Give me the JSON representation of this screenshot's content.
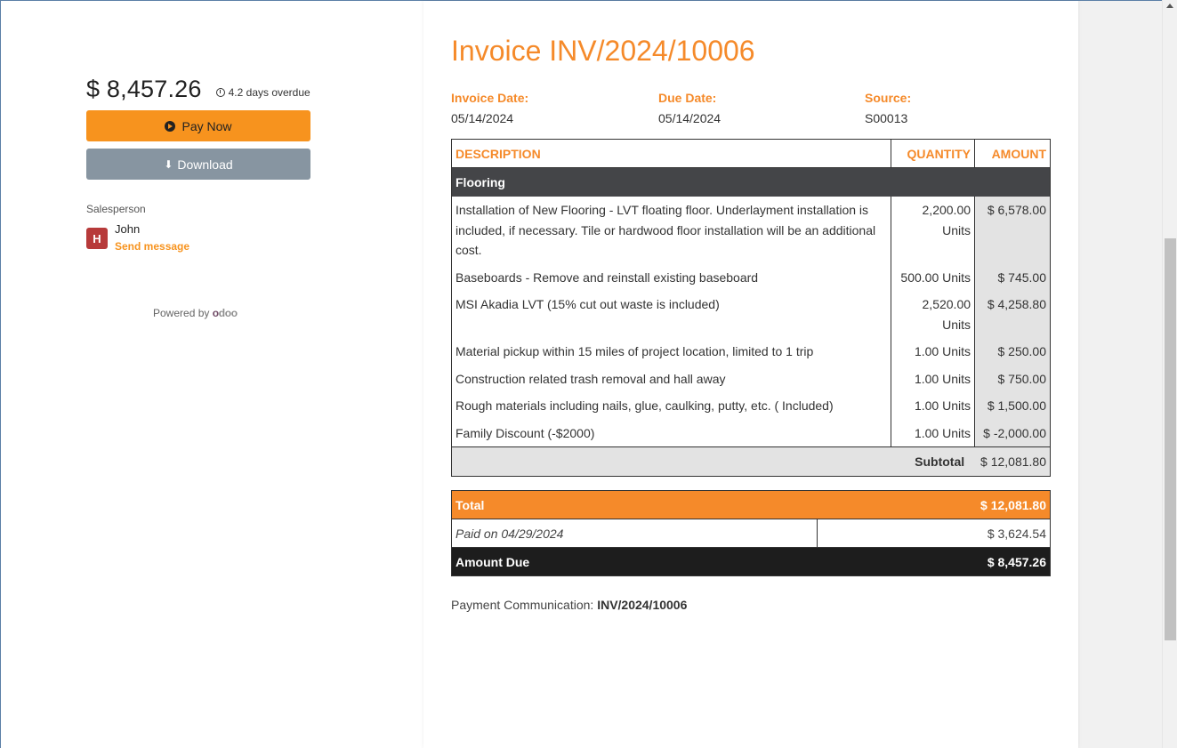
{
  "sidebar": {
    "amount": "$ 8,457.26",
    "overdue": "4.2 days overdue",
    "pay_label": "Pay Now",
    "download_label": "Download",
    "salesperson_label": "Salesperson",
    "avatar_letter": "H",
    "salesperson_name": "John",
    "send_message": "Send message",
    "powered_by": "Powered by",
    "odoo_o": "o",
    "odoo_rest": "doo"
  },
  "invoice": {
    "title": "Invoice INV/2024/10006",
    "invoice_date_label": "Invoice Date:",
    "invoice_date": "05/14/2024",
    "due_date_label": "Due Date:",
    "due_date": "05/14/2024",
    "source_label": "Source:",
    "source": "S00013",
    "headers": {
      "description": "DESCRIPTION",
      "quantity": "QUANTITY",
      "amount": "AMOUNT"
    },
    "section": "Flooring",
    "lines": [
      {
        "description": "Installation of New Flooring - LVT floating floor. Underlayment installation is included, if necessary. Tile or hardwood floor installation will be an additional cost.",
        "quantity": "2,200.00 Units",
        "amount": "$ 6,578.00"
      },
      {
        "description": "Baseboards - Remove and reinstall existing baseboard",
        "quantity": "500.00 Units",
        "amount": "$ 745.00"
      },
      {
        "description": "MSI Akadia LVT (15% cut out waste is included)",
        "quantity": "2,520.00 Units",
        "amount": "$ 4,258.80"
      },
      {
        "description": "Material pickup within 15 miles of project location, limited to 1 trip",
        "quantity": "1.00 Units",
        "amount": "$ 250.00"
      },
      {
        "description": "Construction related trash removal and hall away",
        "quantity": "1.00 Units",
        "amount": "$ 750.00"
      },
      {
        "description": "Rough materials including nails, glue, caulking, putty, etc. ( Included)",
        "quantity": "1.00 Units",
        "amount": "$ 1,500.00"
      },
      {
        "description": "Family Discount (-$2000)",
        "quantity": "1.00 Units",
        "amount": "$ -2,000.00"
      }
    ],
    "subtotal_label": "Subtotal",
    "subtotal": "$ 12,081.80",
    "total_label": "Total",
    "total": "$ 12,081.80",
    "paid_label": "Paid on 04/29/2024",
    "paid_amount": "$ 3,624.54",
    "amount_due_label": "Amount Due",
    "amount_due": "$ 8,457.26",
    "payment_comm_label": "Payment Communication:",
    "payment_comm": "INV/2024/10006"
  },
  "colors": {
    "accent": "#f58a2a",
    "pay_button": "#f7931e",
    "download_button": "#8795a1",
    "dark_row": "#1d1d1d",
    "section_row": "#444548"
  }
}
